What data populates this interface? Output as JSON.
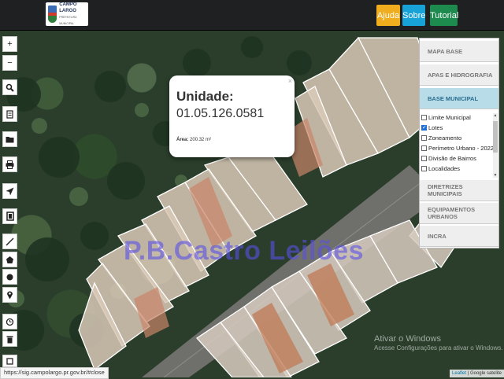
{
  "header": {
    "logo_name": "CAMPO LARGO",
    "logo_sub": "PREFEITURA MUNICIPAL",
    "buttons": {
      "ajuda": "Ajuda",
      "sobre": "Sobre",
      "tutorial": "Tutorial"
    },
    "colors": {
      "ajuda": "#f0ad1e",
      "sobre": "#17a2d8",
      "tutorial": "#1d8a4e"
    }
  },
  "map_tools": {
    "zoom_in": "+",
    "zoom_out": "−",
    "icons": [
      "search-icon",
      "document-icon",
      "folder-icon",
      "print-icon",
      "locate-arrow-icon",
      "layer-page-icon",
      "measure-line-icon",
      "polygon-icon",
      "circle-icon",
      "pin-icon",
      "clock-icon",
      "trash-icon",
      "bottom-tool-icon"
    ]
  },
  "popup": {
    "title": "Unidade:",
    "code": "01.05.126.0581",
    "area_label": "Área:",
    "area_value": "200.32 m²",
    "close": "×"
  },
  "watermark": "P.B.Castro Leilões",
  "layer_panel": {
    "sections_top": [
      "MAPA BASE",
      "APAS E HIDROGRAFIA",
      "BASE MUNICIPAL"
    ],
    "layers": [
      {
        "label": "Limite Municipal",
        "checked": false
      },
      {
        "label": "Lotes",
        "checked": true
      },
      {
        "label": "Zoneamento",
        "checked": false
      },
      {
        "label": "Perímetro Urbano - 2022",
        "checked": false
      },
      {
        "label": "Divisão de Bairros",
        "checked": false
      },
      {
        "label": "Localidades",
        "checked": false
      }
    ],
    "sections_bottom": [
      "DIRETRIZES MUNICIPAIS",
      "EQUIPAMENTOS URBANOS",
      "INCRA"
    ],
    "active_color": "#b8dde9"
  },
  "windows_activation": {
    "line1": "Ativar o Windows",
    "line2": "Acesse Configurações para ativar o Windows."
  },
  "status_url": "https://sig.campolargo.pr.gov.br/#close",
  "attribution": {
    "leaflet": "Leaflet",
    "source": "| Google satelite"
  }
}
